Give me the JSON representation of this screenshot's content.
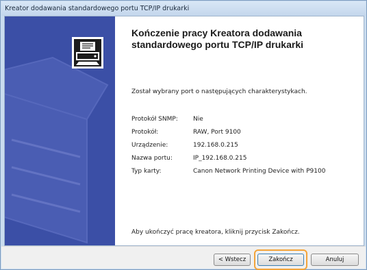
{
  "window": {
    "title": "Kreator dodawania standardowego portu TCP/IP drukarki"
  },
  "wizard": {
    "heading": "Kończenie pracy Kreatora dodawania standardowego portu TCP/IP drukarki",
    "intro": "Został wybrany port o następujących charakterystykach.",
    "properties": [
      {
        "key": "Protokół SNMP:",
        "value": "Nie"
      },
      {
        "key": "Protokół:",
        "value": "RAW, Port 9100"
      },
      {
        "key": "Urządzenie:",
        "value": "192.168.0.215"
      },
      {
        "key": "Nazwa portu:",
        "value": "IP_192.168.0.215"
      },
      {
        "key": "Typ karty:",
        "value": "Canon Network Printing Device with P9100"
      }
    ],
    "outro": "Aby ukończyć pracę kreatora, kliknij przycisk Zakończ."
  },
  "buttons": {
    "back": "< Wstecz",
    "finish": "Zakończ",
    "cancel": "Anuluj"
  },
  "colors": {
    "side_panel": "#3b4fa6",
    "highlight": "#f3a43a"
  }
}
